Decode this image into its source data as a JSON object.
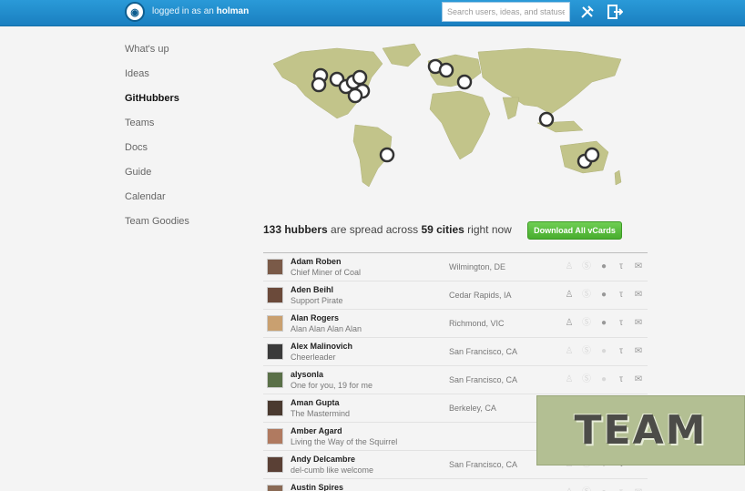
{
  "header": {
    "logged_prefix": "logged in as an",
    "username": "holman",
    "search_placeholder": "Search users, ideas, and statuses",
    "icons": [
      "tools-icon",
      "signout-icon"
    ]
  },
  "sidebar": {
    "items": [
      {
        "label": "What's up",
        "active": false
      },
      {
        "label": "Ideas",
        "active": false
      },
      {
        "label": "GitHubbers",
        "active": true
      },
      {
        "label": "Teams",
        "active": false
      },
      {
        "label": "Docs",
        "active": false
      },
      {
        "label": "Guide",
        "active": false
      },
      {
        "label": "Calendar",
        "active": false
      },
      {
        "label": "Team Goodies",
        "active": false
      }
    ]
  },
  "summary": {
    "count": "133 hubbers",
    "middle": "are spread across",
    "cities": "59 cities",
    "suffix": "right now",
    "button": "Download All vCards"
  },
  "colors": {
    "map_land": "#c2c48a",
    "header_blue": "#1f8ccb",
    "button_green": "#5bbd3f",
    "badge_bg": "#b3bf93"
  },
  "people": [
    {
      "name": "Adam Roben",
      "title": "Chief Miner of Coal",
      "location": "Wilmington, DE",
      "icons_on": [
        false,
        false,
        true,
        true,
        true
      ]
    },
    {
      "name": "Aden Beihl",
      "title": "Support Pirate",
      "location": "Cedar Rapids, IA",
      "icons_on": [
        true,
        false,
        true,
        true,
        true
      ]
    },
    {
      "name": "Alan Rogers",
      "title": "Alan Alan Alan Alan",
      "location": "Richmond, VIC",
      "icons_on": [
        true,
        false,
        true,
        true,
        true
      ]
    },
    {
      "name": "Alex Malinovich",
      "title": "Cheerleader",
      "location": "San Francisco, CA",
      "icons_on": [
        false,
        false,
        false,
        true,
        true
      ]
    },
    {
      "name": "alysonla",
      "title": "One for you, 19 for me",
      "location": "San Francisco, CA",
      "icons_on": [
        false,
        false,
        false,
        true,
        true
      ]
    },
    {
      "name": "Aman Gupta",
      "title": "The Mastermind",
      "location": "Berkeley, CA",
      "icons_on": [
        true,
        false,
        false,
        true,
        true
      ]
    },
    {
      "name": "Amber Agard",
      "title": "Living the Way of the Squirrel",
      "location": "",
      "icons_on": [
        false,
        false,
        false,
        true,
        true
      ]
    },
    {
      "name": "Andy Delcambre",
      "title": "del-cumb like welcome",
      "location": "San Francisco, CA",
      "icons_on": [
        false,
        false,
        true,
        true,
        true
      ]
    },
    {
      "name": "Austin Spires",
      "title": "",
      "location": "",
      "icons_on": [
        false,
        false,
        false,
        false,
        false
      ]
    }
  ],
  "badge": {
    "text": "TEAM"
  }
}
